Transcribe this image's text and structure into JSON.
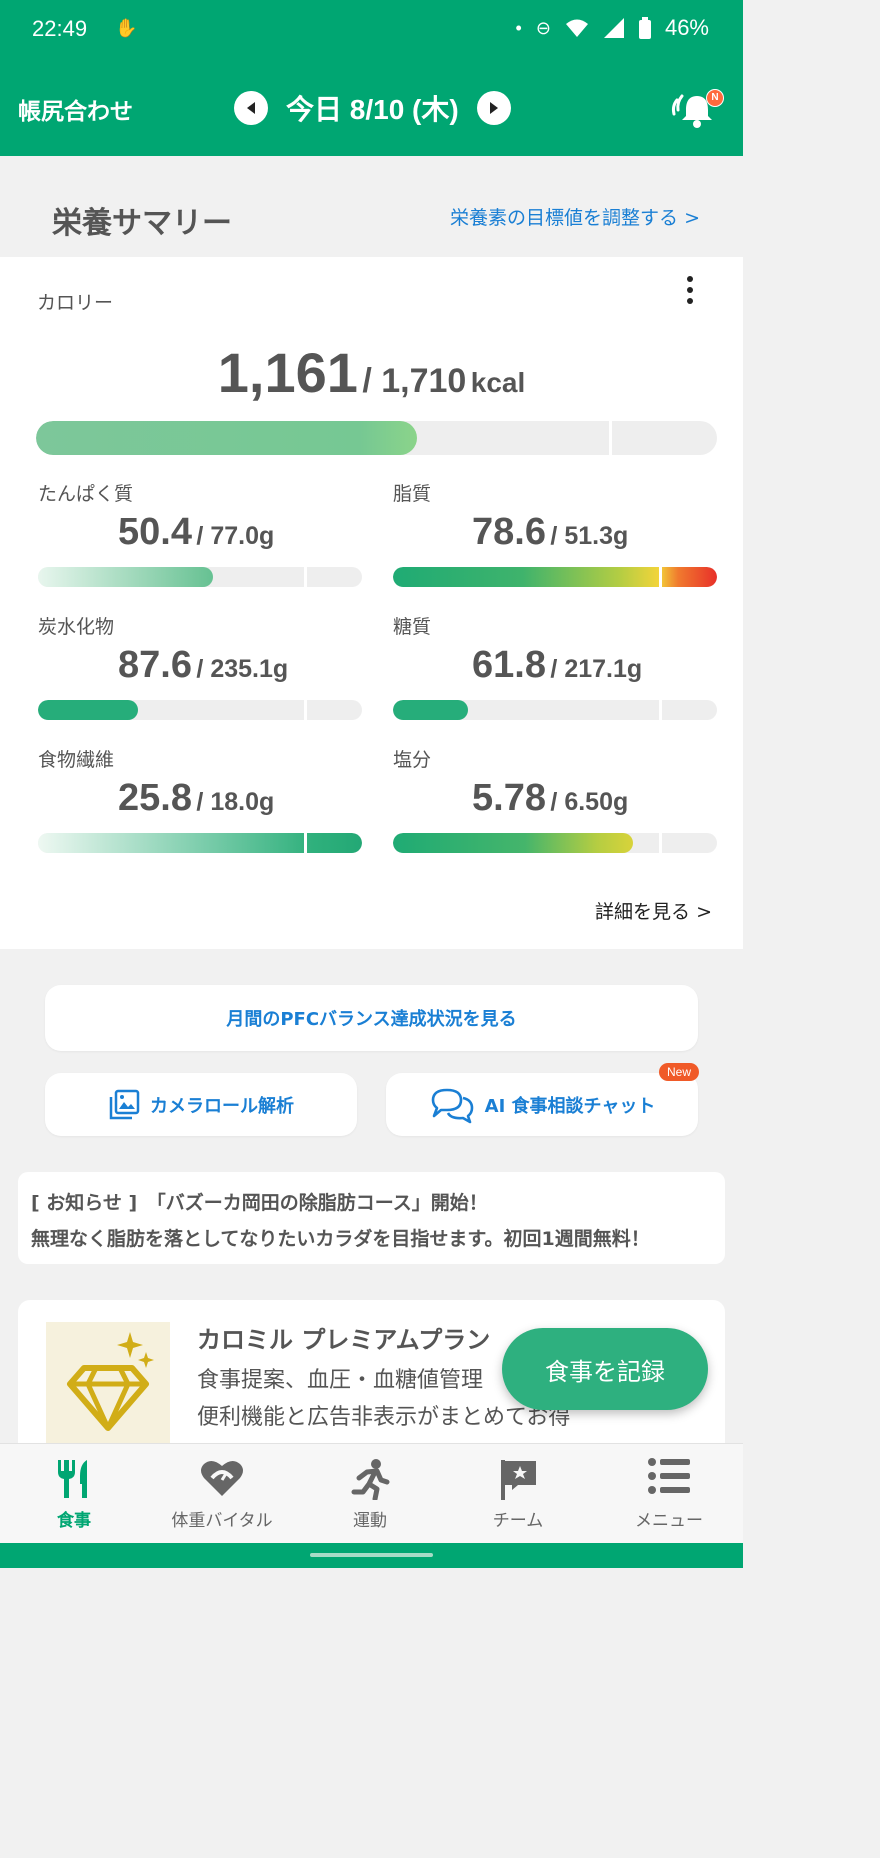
{
  "status_bar": {
    "time": "22:49",
    "battery": "46%"
  },
  "header": {
    "left_title": "帳尻合わせ",
    "date": "今日 8/10 (木)",
    "notification_badge": "N"
  },
  "summary": {
    "title": "栄養サマリー",
    "adjust_link": "栄養素の目標値を調整する >"
  },
  "calories": {
    "label": "カロリー",
    "value": "1,161",
    "target": "/ 1,710",
    "unit": "kcal",
    "progress": 0.56
  },
  "nutrients": [
    {
      "label": "たんぱく質",
      "value": "50.4",
      "target": "/ 77.0g",
      "progress": 0.54
    },
    {
      "label": "脂質",
      "value": "78.6",
      "target": "/ 51.3g",
      "progress": 1.0
    },
    {
      "label": "炭水化物",
      "value": "87.6",
      "target": "/ 235.1g",
      "progress": 0.31
    },
    {
      "label": "糖質",
      "value": "61.8",
      "target": "/ 217.1g",
      "progress": 0.23
    },
    {
      "label": "食物繊維",
      "value": "25.8",
      "target": "/ 18.0g",
      "progress": 1.0
    },
    {
      "label": "塩分",
      "value": "5.78",
      "target": "/ 6.50g",
      "progress": 0.74
    }
  ],
  "detail_link": "詳細を見る >",
  "buttons": {
    "pfc": "月間のPFCバランス達成状況を見る",
    "camera": "カメラロール解析",
    "ai_chat": "AI 食事相談チャット",
    "new_badge": "New"
  },
  "notice": {
    "line1": "[ お知らせ ]　「バズーカ岡田の除脂肪コース」開始！",
    "line2": "無理なく脂肪を落としてなりたいカラダを目指せます。初回1週間無料！"
  },
  "premium": {
    "title": "カロミル プレミアムプラン",
    "line1": "食事提案、血圧・血糖値管理",
    "line2": "便利機能と広告非表示がまとめてお得"
  },
  "fab_label": "食事を記録",
  "bottom_nav": [
    {
      "label": "食事",
      "icon": "fork-knife-icon"
    },
    {
      "label": "体重バイタル",
      "icon": "heart-scale-icon"
    },
    {
      "label": "運動",
      "icon": "runner-icon"
    },
    {
      "label": "チーム",
      "icon": "flag-icon"
    },
    {
      "label": "メニュー",
      "icon": "list-icon"
    }
  ],
  "colors": {
    "brand": "#00a672",
    "link": "#1a7fd4",
    "over_limit": "#e8302a",
    "warning": "#f5d43a"
  }
}
